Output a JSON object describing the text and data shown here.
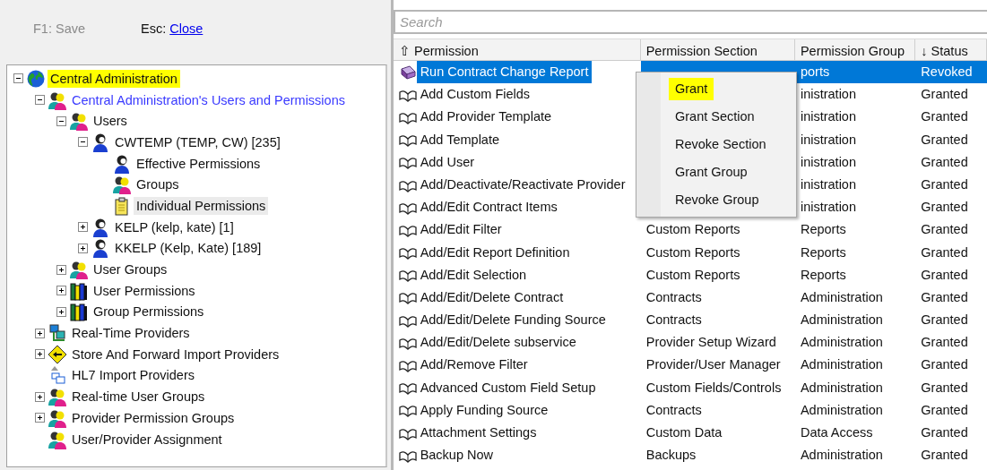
{
  "toolbar": {
    "save": {
      "label": "F1: Save",
      "disabled": true
    },
    "close": {
      "key": "Esc:",
      "label": "Close"
    }
  },
  "tree": [
    {
      "label": "Central Administration",
      "kind": "globe",
      "expanded": true,
      "selected": true,
      "hovered": false,
      "children": [
        {
          "label": "Central Administration's Users and Permissions",
          "kind": "people",
          "expanded": true,
          "selected": false,
          "hovered": false,
          "color": "#3a3aff",
          "children": [
            {
              "label": "Users",
              "kind": "people",
              "expanded": true,
              "selected": false,
              "hovered": false,
              "children": [
                {
                  "label": "CWTEMP (TEMP, CW) [235]",
                  "kind": "person",
                  "expanded": true,
                  "selected": false,
                  "hovered": false,
                  "children": [
                    {
                      "label": "Effective Permissions",
                      "kind": "person",
                      "selected": false,
                      "hovered": false
                    },
                    {
                      "label": "Groups",
                      "kind": "people",
                      "selected": false,
                      "hovered": false
                    },
                    {
                      "label": "Individual Permissions",
                      "kind": "clipboard",
                      "selected": false,
                      "hovered": true
                    }
                  ]
                },
                {
                  "label": "KELP (kelp, kate) [1]",
                  "kind": "person",
                  "expanded": false,
                  "selected": false,
                  "hovered": false
                },
                {
                  "label": "KKELP (Kelp, Kate) [189]",
                  "kind": "person",
                  "expanded": false,
                  "selected": false,
                  "hovered": false
                }
              ]
            },
            {
              "label": "User Groups",
              "kind": "people",
              "expanded": false,
              "selected": false,
              "hovered": false
            },
            {
              "label": "User Permissions",
              "kind": "books",
              "expanded": false,
              "selected": false,
              "hovered": false
            },
            {
              "label": "Group Permissions",
              "kind": "books",
              "expanded": false,
              "selected": false,
              "hovered": false
            }
          ]
        },
        {
          "label": "Real-Time Providers",
          "kind": "network",
          "expanded": false,
          "selected": false,
          "hovered": false
        },
        {
          "label": "Store And Forward Import Providers",
          "kind": "sign",
          "expanded": false,
          "selected": false,
          "hovered": false
        },
        {
          "label": "HL7 Import Providers",
          "kind": "hl7",
          "selected": false,
          "hovered": false
        },
        {
          "label": "Real-time User Groups",
          "kind": "people",
          "expanded": false,
          "selected": false,
          "hovered": false
        },
        {
          "label": "Provider Permission Groups",
          "kind": "people",
          "expanded": false,
          "selected": false,
          "hovered": false
        },
        {
          "label": "User/Provider Assignment",
          "kind": "people",
          "selected": false,
          "hovered": false
        }
      ]
    }
  ],
  "search": {
    "placeholder": "Search"
  },
  "table": {
    "columns": [
      {
        "label": "Permission",
        "sort_mark": "⇧"
      },
      {
        "label": "Permission Section"
      },
      {
        "label": "Permission Group"
      },
      {
        "label": "Status",
        "sort_mark": "↓"
      }
    ],
    "rows": [
      {
        "kind": "closed",
        "selected": true,
        "permission": "Run Contract Change Report",
        "group": "ports",
        "status": "Revoked"
      },
      {
        "kind": "open",
        "selected": false,
        "permission": "Add Custom Fields",
        "group": "inistration",
        "status": "Granted"
      },
      {
        "kind": "open",
        "selected": false,
        "permission": "Add Provider Template",
        "group": "inistration",
        "status": "Granted"
      },
      {
        "kind": "open",
        "selected": false,
        "permission": "Add Template",
        "group": "inistration",
        "status": "Granted"
      },
      {
        "kind": "open",
        "selected": false,
        "permission": "Add User",
        "group": "inistration",
        "status": "Granted"
      },
      {
        "kind": "open",
        "selected": false,
        "permission": "Add/Deactivate/Reactivate Provider",
        "group": "inistration",
        "status": "Granted"
      },
      {
        "kind": "open",
        "selected": false,
        "permission": "Add/Edit Contract Items",
        "group": "inistration",
        "status": "Granted"
      },
      {
        "kind": "open",
        "selected": false,
        "permission": "Add/Edit Filter",
        "section": "Custom Reports",
        "group": "Reports",
        "status": "Granted"
      },
      {
        "kind": "open",
        "selected": false,
        "permission": "Add/Edit Report Definition",
        "section": "Custom Reports",
        "group": "Reports",
        "status": "Granted"
      },
      {
        "kind": "open",
        "selected": false,
        "permission": "Add/Edit Selection",
        "section": "Custom Reports",
        "group": "Reports",
        "status": "Granted"
      },
      {
        "kind": "open",
        "selected": false,
        "permission": "Add/Edit/Delete Contract",
        "section": "Contracts",
        "group": "Administration",
        "status": "Granted"
      },
      {
        "kind": "open",
        "selected": false,
        "permission": "Add/Edit/Delete Funding Source",
        "section": "Contracts",
        "group": "Administration",
        "status": "Granted"
      },
      {
        "kind": "open",
        "selected": false,
        "permission": "Add/Edit/Delete subservice",
        "section": "Provider Setup Wizard",
        "group": "Administration",
        "status": "Granted"
      },
      {
        "kind": "open",
        "selected": false,
        "permission": "Add/Remove Filter",
        "section": "Provider/User Manager",
        "group": "Administration",
        "status": "Granted"
      },
      {
        "kind": "open",
        "selected": false,
        "permission": "Advanced Custom Field Setup",
        "section": "Custom Fields/Controls",
        "group": "Administration",
        "status": "Granted"
      },
      {
        "kind": "open",
        "selected": false,
        "permission": "Apply Funding Source",
        "section": "Contracts",
        "group": "Administration",
        "status": "Granted"
      },
      {
        "kind": "open",
        "selected": false,
        "permission": "Attachment Settings",
        "section": "Custom Data",
        "group": "Data Access",
        "status": "Granted"
      },
      {
        "kind": "open",
        "selected": false,
        "permission": "Backup Now",
        "section": "Backups",
        "group": "Administration",
        "status": "Granted"
      }
    ]
  },
  "context_menu": [
    {
      "label": "Grant",
      "selected": true
    },
    {
      "label": "Grant Section",
      "selected": false
    },
    {
      "label": "Revoke Section",
      "selected": false
    },
    {
      "label": "Grant Group",
      "selected": false
    },
    {
      "label": "Revoke Group",
      "selected": false
    }
  ]
}
